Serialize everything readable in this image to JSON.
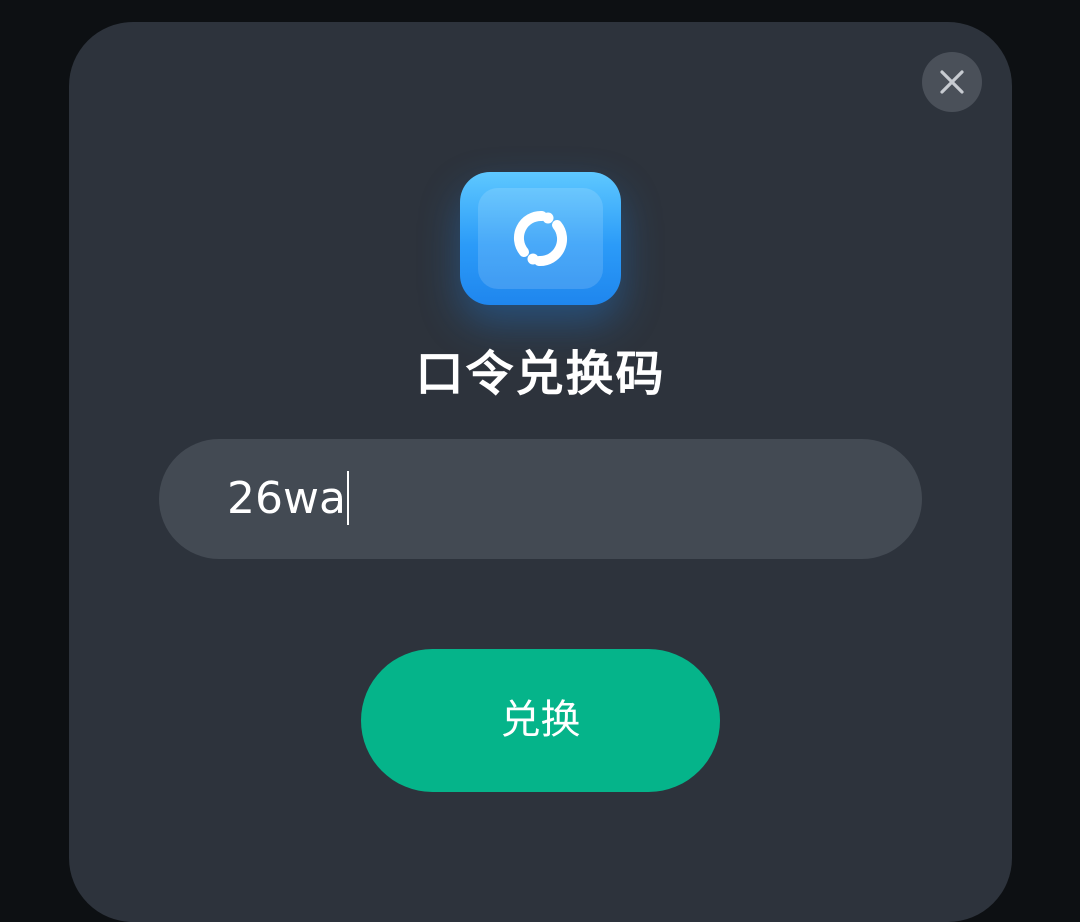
{
  "dialog": {
    "close_icon": "close-icon",
    "app_icon": "exchange-ticket-icon",
    "title": "口令兑换码",
    "input": {
      "value": "26wa",
      "placeholder": ""
    },
    "submit_label": "兑换"
  },
  "colors": {
    "backdrop": "#0d1013",
    "dialog_bg": "#2d333c",
    "input_bg": "#434a53",
    "accent_green": "#05b48a",
    "icon_blue": "#2b9bf8"
  }
}
